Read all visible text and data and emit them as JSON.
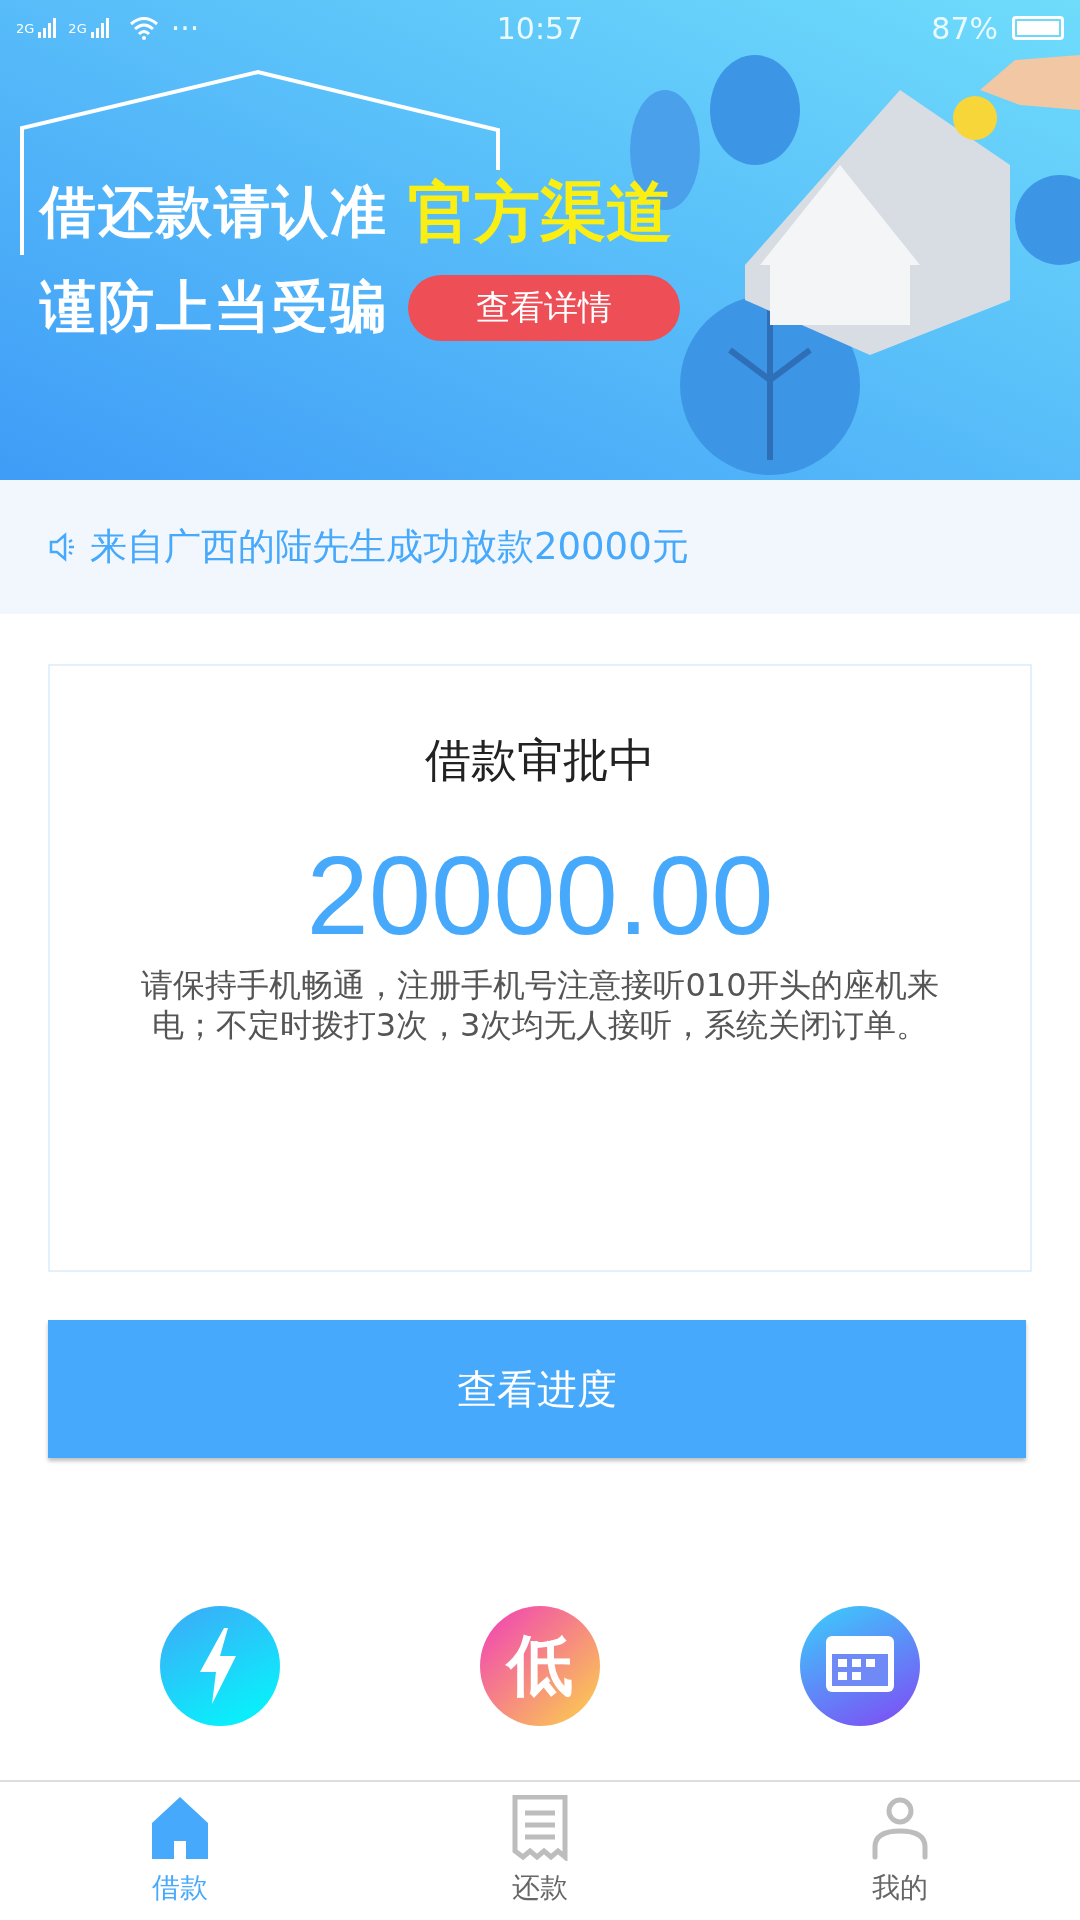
{
  "status_bar": {
    "signal_1": "2G",
    "signal_2": "2G",
    "dots": "···",
    "time": "10:57",
    "battery": "87%"
  },
  "banner": {
    "line_1": "借还款请认准",
    "highlight": "官方渠道",
    "line_2": "谨防上当受骗",
    "button": "查看详情"
  },
  "notice": {
    "text": "来自广西的陆先生成功放款20000元"
  },
  "status_card": {
    "title": "借款审批中",
    "amount": "20000.00",
    "note": "请保持手机畅通，注册手机号注意接听010开头的座机来电；不定时拨打3次，3次均无人接听，系统关闭订单。"
  },
  "progress_button": "查看进度",
  "features": [
    {
      "kind": "bolt"
    },
    {
      "kind": "low"
    },
    {
      "kind": "calendar"
    }
  ],
  "features_low_glyph": "低",
  "tabs": [
    {
      "label": "借款",
      "kind": "home",
      "selected": true
    },
    {
      "label": "还款",
      "kind": "receipt",
      "selected": false
    },
    {
      "label": "我的",
      "kind": "person",
      "selected": false
    }
  ]
}
